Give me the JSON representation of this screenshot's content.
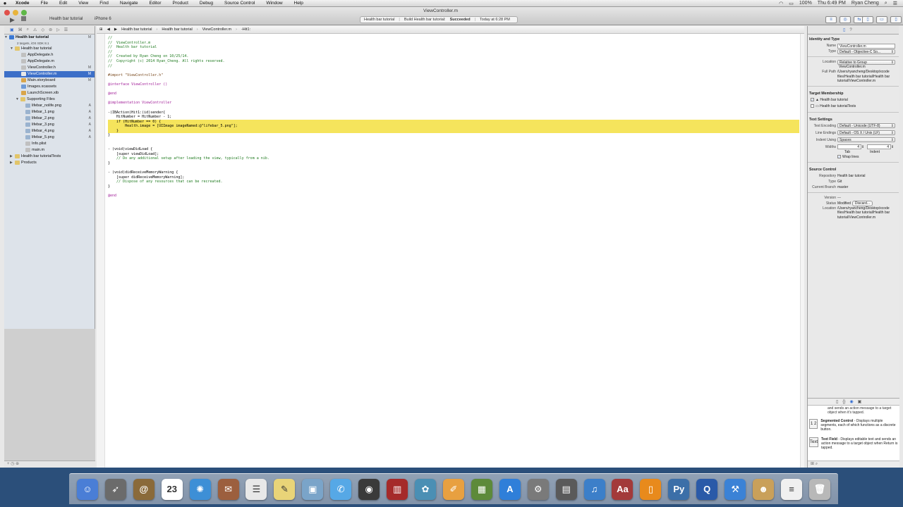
{
  "menubar": {
    "app": "Xcode",
    "items": [
      "File",
      "Edit",
      "View",
      "Find",
      "Navigate",
      "Editor",
      "Product",
      "Debug",
      "Source Control",
      "Window",
      "Help"
    ],
    "clock": "Thu 6:49 PM",
    "user": "Ryan Cheng",
    "battery": "100%"
  },
  "toolbar": {
    "window_title": "ViewController.m",
    "scheme": "Health bar tutorial",
    "device": "iPhone 6",
    "activity_project": "Health bar tutorial",
    "activity_status_prefix": "Build Health bar tutorial:",
    "activity_status": "Succeeded",
    "activity_time": "Today at 6:28 PM"
  },
  "navigator": {
    "project": "Health bar tutorial",
    "project_sub": "2 targets, iOS SDK 8.1",
    "group": "Health bar tutorial",
    "files": [
      {
        "name": "AppDelegate.h",
        "badge": ""
      },
      {
        "name": "AppDelegate.m",
        "badge": ""
      },
      {
        "name": "ViewController.h",
        "badge": "M"
      },
      {
        "name": "ViewController.m",
        "badge": "M"
      },
      {
        "name": "Main.storyboard",
        "badge": "M"
      },
      {
        "name": "Images.xcassets",
        "badge": ""
      },
      {
        "name": "LaunchScreen.xib",
        "badge": ""
      }
    ],
    "supporting_group": "Supporting Files",
    "supporting_files": [
      {
        "name": "lifebar_nolife.png",
        "badge": "A"
      },
      {
        "name": "lifebar_1.png",
        "badge": "A"
      },
      {
        "name": "lifebar_2.png",
        "badge": "A"
      },
      {
        "name": "lifebar_3.png",
        "badge": "A"
      },
      {
        "name": "lifebar_4.png",
        "badge": "A"
      },
      {
        "name": "lifebar_5.png",
        "badge": "A"
      },
      {
        "name": "Info.plist",
        "badge": ""
      },
      {
        "name": "main.m",
        "badge": ""
      }
    ],
    "tests_group": "Health bar tutorialTests",
    "products_group": "Products",
    "project_badge": "M"
  },
  "jumpbar": {
    "crumbs": [
      "Health bar tutorial",
      "Health bar tutorial",
      "ViewController.m",
      "-Hit1:"
    ]
  },
  "code_lines": [
    {
      "t": "//",
      "c": "cmt"
    },
    {
      "t": "//  ViewController.m",
      "c": "cmt"
    },
    {
      "t": "//  Health bar tutorial",
      "c": "cmt"
    },
    {
      "t": "//",
      "c": "cmt"
    },
    {
      "t": "//  Created by Ryan Cheng on 10/25/14.",
      "c": "cmt"
    },
    {
      "t": "//  Copyright (c) 2014 Ryan_Cheng. All rights reserved.",
      "c": "cmt"
    },
    {
      "t": "//",
      "c": "cmt"
    },
    {
      "t": "",
      "c": ""
    },
    {
      "t": "#import \"ViewController.h\"",
      "c": "pp"
    },
    {
      "t": "",
      "c": ""
    },
    {
      "t": "@interface ViewController ()",
      "c": "kw"
    },
    {
      "t": "",
      "c": ""
    },
    {
      "t": "@end",
      "c": "kw"
    },
    {
      "t": "",
      "c": ""
    },
    {
      "t": "@implementation ViewController",
      "c": "kw"
    },
    {
      "t": "",
      "c": ""
    },
    {
      "t": "-(IBAction)Hit1:(id)sender{",
      "c": ""
    },
    {
      "t": "    HitNumber = HitNumber - 1;",
      "c": ""
    },
    {
      "t": "    if (HitNumber == 0) {",
      "c": "",
      "hl": true
    },
    {
      "t": "        Health.image = [UIImage imageNamed:@\"lifebar_5.png\"];",
      "c": "",
      "hl": true
    },
    {
      "t": "    }",
      "c": "",
      "hl": true
    },
    {
      "t": "}",
      "c": ""
    },
    {
      "t": "",
      "c": ""
    },
    {
      "t": "",
      "c": ""
    },
    {
      "t": "- (void)viewDidLoad {",
      "c": ""
    },
    {
      "t": "    [super viewDidLoad];",
      "c": ""
    },
    {
      "t": "    // Do any additional setup after loading the view, typically from a nib.",
      "c": "cmt"
    },
    {
      "t": "}",
      "c": ""
    },
    {
      "t": "",
      "c": ""
    },
    {
      "t": "- (void)didReceiveMemoryWarning {",
      "c": ""
    },
    {
      "t": "    [super didReceiveMemoryWarning];",
      "c": ""
    },
    {
      "t": "    // Dispose of any resources that can be recreated.",
      "c": "cmt"
    },
    {
      "t": "}",
      "c": ""
    },
    {
      "t": "",
      "c": ""
    },
    {
      "t": "@end",
      "c": "kw"
    }
  ],
  "inspector": {
    "identity_title": "Identity and Type",
    "name_label": "Name",
    "name_value": "ViewController.m",
    "type_label": "Type",
    "type_value": "Default - Objective-C So...",
    "location_label": "Location",
    "location_value": "Relative to Group",
    "location_file": "ViewController.m",
    "fullpath_label": "Full Path",
    "fullpath_value": "/Users/ryancheng/Desktop/xcode files/Health bar tutorial/Health bar tutorial/ViewController.m",
    "membership_title": "Target Membership",
    "membership": [
      "Health bar tutorial",
      "Health bar tutorialTests"
    ],
    "text_title": "Text Settings",
    "encoding_label": "Text Encoding",
    "encoding_value": "Default - Unicode (UTF-8)",
    "endings_label": "Line Endings",
    "endings_value": "Default - OS X / Unix (LF)",
    "indent_label": "Indent Using",
    "indent_value": "Spaces",
    "widths_label": "Widths",
    "tab_value": "4",
    "indent_width_value": "4",
    "tab_caption": "Tab",
    "indent_caption": "Indent",
    "wrap_label": "Wrap lines",
    "sc_title": "Source Control",
    "repo_label": "Repository",
    "repo_value": "Health bar tutorial",
    "sctype_label": "Type",
    "sctype_value": "Git",
    "branch_label": "Current Branch",
    "branch_value": "master",
    "version_label": "Version",
    "version_value": "---",
    "status_label": "Status",
    "status_value": "Modified",
    "discard_label": "Discard...",
    "sclocation_label": "Location",
    "sclocation_value": "/Users/ryancheng/Desktop/xcode files/Health bar tutorial/Health bar tutorial/ViewController.m"
  },
  "library": {
    "partial_desc": "and sends an action message to a target object when it's tapped.",
    "items": [
      {
        "icon": "1 2",
        "name": "Segmented Control",
        "desc": "- Displays multiple segments, each of which functions as a discrete button."
      },
      {
        "icon": "Text",
        "name": "Text Field",
        "desc": "- Displays editable text and sends an action message to a target object when Return is tapped."
      }
    ]
  },
  "dock": {
    "icons": [
      {
        "name": "finder-icon",
        "color": "#4a7ed6",
        "glyph": "☺"
      },
      {
        "name": "launchpad-icon",
        "color": "#6b6b6b",
        "glyph": "➶"
      },
      {
        "name": "mail-icon",
        "color": "#8a6a3a",
        "glyph": "@"
      },
      {
        "name": "calendar-icon",
        "color": "#ffffff",
        "glyph": "23"
      },
      {
        "name": "safari-icon",
        "color": "#3d8fd6",
        "glyph": "✺"
      },
      {
        "name": "stamp-icon",
        "color": "#9c5f3e",
        "glyph": "✉"
      },
      {
        "name": "reminders-icon",
        "color": "#e8e8e8",
        "glyph": "☰"
      },
      {
        "name": "notes-icon",
        "color": "#e9d478",
        "glyph": "✎"
      },
      {
        "name": "preview-icon",
        "color": "#7aa4c9",
        "glyph": "▣"
      },
      {
        "name": "messages-icon",
        "color": "#56a8e6",
        "glyph": "✆"
      },
      {
        "name": "camera-icon",
        "color": "#3a3a3a",
        "glyph": "◉"
      },
      {
        "name": "photobooth-icon",
        "color": "#a52a2a",
        "glyph": "▥"
      },
      {
        "name": "iphoto-icon",
        "color": "#4b8fb4",
        "glyph": "✿"
      },
      {
        "name": "pages-icon",
        "color": "#e8a040",
        "glyph": "✐"
      },
      {
        "name": "minecraft-icon",
        "color": "#5d8a3a",
        "glyph": "▦"
      },
      {
        "name": "appstore-icon",
        "color": "#2f7fd9",
        "glyph": "A"
      },
      {
        "name": "system-preferences-icon",
        "color": "#7a7a7a",
        "glyph": "⚙"
      },
      {
        "name": "calculator-icon",
        "color": "#5a5a5a",
        "glyph": "▤"
      },
      {
        "name": "itunes-icon",
        "color": "#3c7fc9",
        "glyph": "♫"
      },
      {
        "name": "dictionary-icon",
        "color": "#a33a3a",
        "glyph": "Aa"
      },
      {
        "name": "ibooks-icon",
        "color": "#e88a1c",
        "glyph": "▯"
      },
      {
        "name": "python-icon",
        "color": "#3c6fa8",
        "glyph": "Py"
      },
      {
        "name": "quicktime-icon",
        "color": "#2a5aa8",
        "glyph": "Q"
      },
      {
        "name": "xcode-icon",
        "color": "#3b82d6",
        "glyph": "⚒"
      },
      {
        "name": "character-icon",
        "color": "#c9a05a",
        "glyph": "☻"
      },
      {
        "name": "document-icon",
        "color": "#f0f0f0",
        "glyph": "≡"
      },
      {
        "name": "trash-icon",
        "color": "#b8b8b8",
        "glyph": "🗑"
      }
    ]
  }
}
